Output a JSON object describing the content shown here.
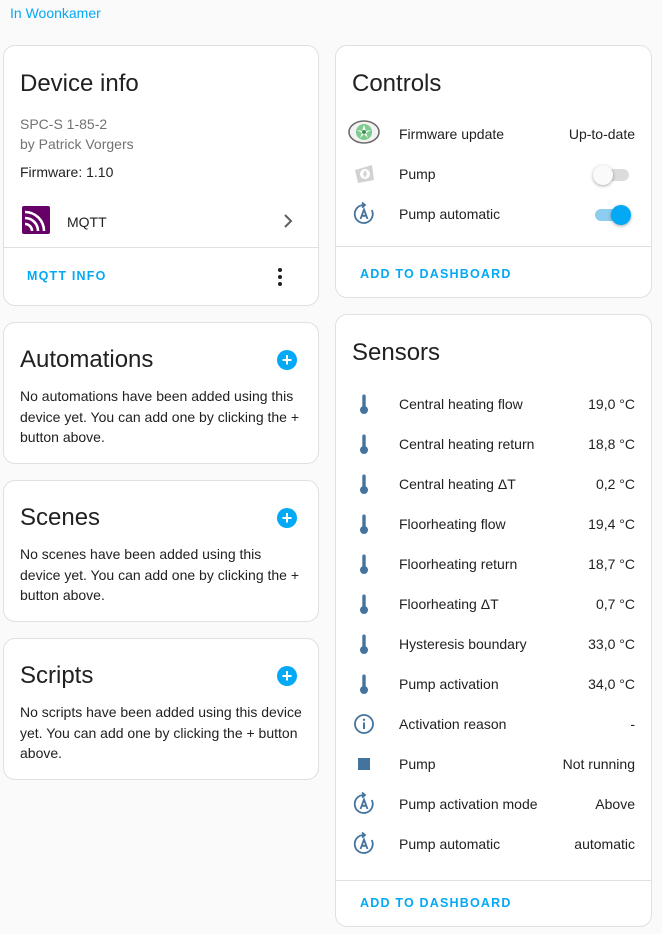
{
  "area_link": "In Woonkamer",
  "device_info": {
    "title": "Device info",
    "model": "SPC-S 1-85-2",
    "manufacturer": "by Patrick Vorgers",
    "firmware": "Firmware: 1.10",
    "integration": "MQTT",
    "action": "MQTT INFO",
    "integration_color": "#660066"
  },
  "automations": {
    "title": "Automations",
    "empty_text": "No automations have been added using this device yet. You can add one by clicking the + button above."
  },
  "scenes": {
    "title": "Scenes",
    "empty_text": "No scenes have been added using this device yet. You can add one by clicking the + button above."
  },
  "scripts": {
    "title": "Scripts",
    "empty_text": "No scripts have been added using this device yet. You can add one by clicking the + button above."
  },
  "controls": {
    "title": "Controls",
    "items": [
      {
        "label": "Firmware update",
        "value": "Up-to-date",
        "icon": "firmware-update-icon"
      },
      {
        "label": "Pump",
        "state": "off",
        "icon": "pump-icon"
      },
      {
        "label": "Pump automatic",
        "state": "on",
        "icon": "auto-mode-icon"
      }
    ],
    "action": "ADD TO DASHBOARD"
  },
  "sensors": {
    "title": "Sensors",
    "items": [
      {
        "label": "Central heating flow",
        "value": "19,0 °C",
        "icon": "thermometer-icon"
      },
      {
        "label": "Central heating return",
        "value": "18,8 °C",
        "icon": "thermometer-icon"
      },
      {
        "label": "Central heating ΔT",
        "value": "0,2 °C",
        "icon": "thermometer-icon"
      },
      {
        "label": "Floorheating flow",
        "value": "19,4 °C",
        "icon": "thermometer-icon"
      },
      {
        "label": "Floorheating return",
        "value": "18,7 °C",
        "icon": "thermometer-icon"
      },
      {
        "label": "Floorheating ΔT",
        "value": "0,7 °C",
        "icon": "thermometer-icon"
      },
      {
        "label": "Hysteresis boundary",
        "value": "33,0 °C",
        "icon": "thermometer-icon"
      },
      {
        "label": "Pump activation",
        "value": "34,0 °C",
        "icon": "thermometer-icon"
      },
      {
        "label": "Activation reason",
        "value": "-",
        "icon": "info-icon"
      },
      {
        "label": "Pump",
        "value": "Not running",
        "icon": "square-icon"
      },
      {
        "label": "Pump activation mode",
        "value": "Above",
        "icon": "auto-mode-icon"
      },
      {
        "label": "Pump automatic",
        "value": "automatic",
        "icon": "auto-mode-icon"
      }
    ],
    "action": "ADD TO DASHBOARD"
  },
  "colors": {
    "accent": "#03a9f4",
    "icon": "#44739e",
    "text": "#212121",
    "secondary_text": "#727272"
  }
}
